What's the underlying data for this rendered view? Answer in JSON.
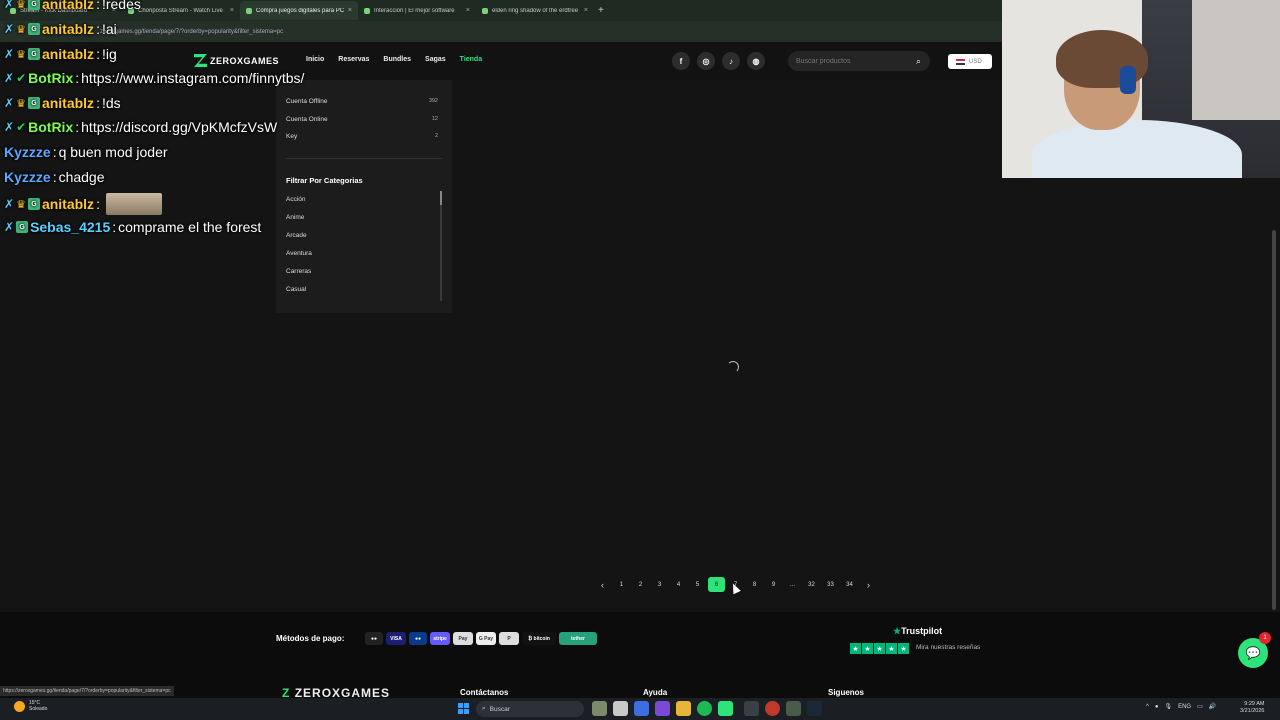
{
  "browser": {
    "tabs": [
      {
        "title": "Stream - Kick Dashboard",
        "active": false
      },
      {
        "title": "Choriposta Stream - Watch Live",
        "active": false
      },
      {
        "title": "Compra juegos digitales para PC",
        "active": true
      },
      {
        "title": "Interacción | El mejor software",
        "active": false
      },
      {
        "title": "elden ring shadow of the erdtree",
        "active": false
      }
    ],
    "url": "zeroxgames.gg/tienda/page/7/?orderby=popularity&filter_sistema=pc"
  },
  "site": {
    "logo_text": "ZEROXGAMES",
    "nav": [
      "Inicio",
      "Reservas",
      "Bundles",
      "Sagas",
      "Tienda"
    ],
    "nav_active": "Tienda",
    "socials": [
      "f",
      "◎",
      "♪",
      "◍"
    ],
    "search_placeholder": "Buscar productos",
    "currency": "USD"
  },
  "filters": {
    "types": [
      {
        "label": "Cuenta Offline",
        "count": "392"
      },
      {
        "label": "Cuenta Online",
        "count": "12"
      },
      {
        "label": "Key",
        "count": "2"
      }
    ],
    "categories_title": "Filtrar Por Categorias",
    "categories": [
      "Acción",
      "Anime",
      "Arcade",
      "Aventura",
      "Carreras",
      "Casual"
    ]
  },
  "pagination": {
    "prev": "‹",
    "next": "›",
    "pages": [
      "1",
      "2",
      "3",
      "4",
      "5",
      "6",
      "7",
      "8",
      "9",
      "...",
      "32",
      "33",
      "34"
    ],
    "active": "6"
  },
  "footer": {
    "payment_label": "Métodos de pago:",
    "payment_methods": [
      {
        "label": "●●",
        "bg": "#222222",
        "w": 18
      },
      {
        "label": "VISA",
        "bg": "#1a1f71",
        "w": 20
      },
      {
        "label": "●●",
        "bg": "#0a3a8a",
        "w": 18
      },
      {
        "label": "stripe",
        "bg": "#635bff",
        "w": 20
      },
      {
        "label": "Pay",
        "bg": "#dddddd",
        "w": 20
      },
      {
        "label": "G Pay",
        "bg": "#eeeeee",
        "w": 20
      },
      {
        "label": "P",
        "bg": "#dddddd",
        "w": 20
      },
      {
        "label": "₿ bitcoin",
        "bg": "#111111",
        "w": 34
      },
      {
        "label": "tether",
        "bg": "#26a17b",
        "w": 38
      }
    ],
    "trustpilot": "Trustpilot",
    "reviews_link": "Mira nuestras reseñas",
    "columns": [
      "Contáctanos",
      "Ayuda",
      "Siguenos"
    ],
    "chat_badge": "1",
    "status_url": "https://zeroxgames.gg/tienda/page/7/?orderby=popularity&filter_sistema=pc"
  },
  "chat": [
    {
      "user": "anitablz",
      "text": " !redes",
      "color": "#ffc730",
      "badges": [
        "sword",
        "crown",
        "sub"
      ]
    },
    {
      "user": "anitablz",
      "text": " !ai",
      "color": "#ffc730",
      "badges": [
        "sword",
        "crown",
        "sub"
      ]
    },
    {
      "user": "anitablz",
      "text": " !ig",
      "color": "#ffc730",
      "badges": [
        "sword",
        "crown",
        "sub"
      ]
    },
    {
      "user": "BotRix",
      "text": " https://www.instagram.com/finnytbs/",
      "color": "#7cff4a",
      "badges": [
        "sword",
        "check"
      ]
    },
    {
      "user": "anitablz",
      "text": " !ds",
      "color": "#ffc730",
      "badges": [
        "sword",
        "crown",
        "sub"
      ]
    },
    {
      "user": "BotRix",
      "text": " https://discord.gg/VpKMcfzVsW",
      "color": "#7cff4a",
      "badges": [
        "sword",
        "check"
      ]
    },
    {
      "user": "Kyzzze",
      "text": " q buen mod joder",
      "color": "#5aa8ff",
      "badges": []
    },
    {
      "user": "Kyzzze",
      "text": " chadge",
      "color": "#5aa8ff",
      "badges": []
    },
    {
      "user": "anitablz",
      "text": "",
      "color": "#ffc730",
      "badges": [
        "sword",
        "crown",
        "sub"
      ],
      "emote": true
    },
    {
      "user": "Sebas_4215",
      "text": " comprame el the forest",
      "color": "#5ad0ff",
      "badges": [
        "sword",
        "sub"
      ]
    }
  ],
  "taskbar": {
    "weather_temp": "15°C",
    "weather_desc": "Soleado",
    "search": "Buscar",
    "lang": "ENG",
    "time": "9:29 AM",
    "date": "3/21/2026"
  }
}
